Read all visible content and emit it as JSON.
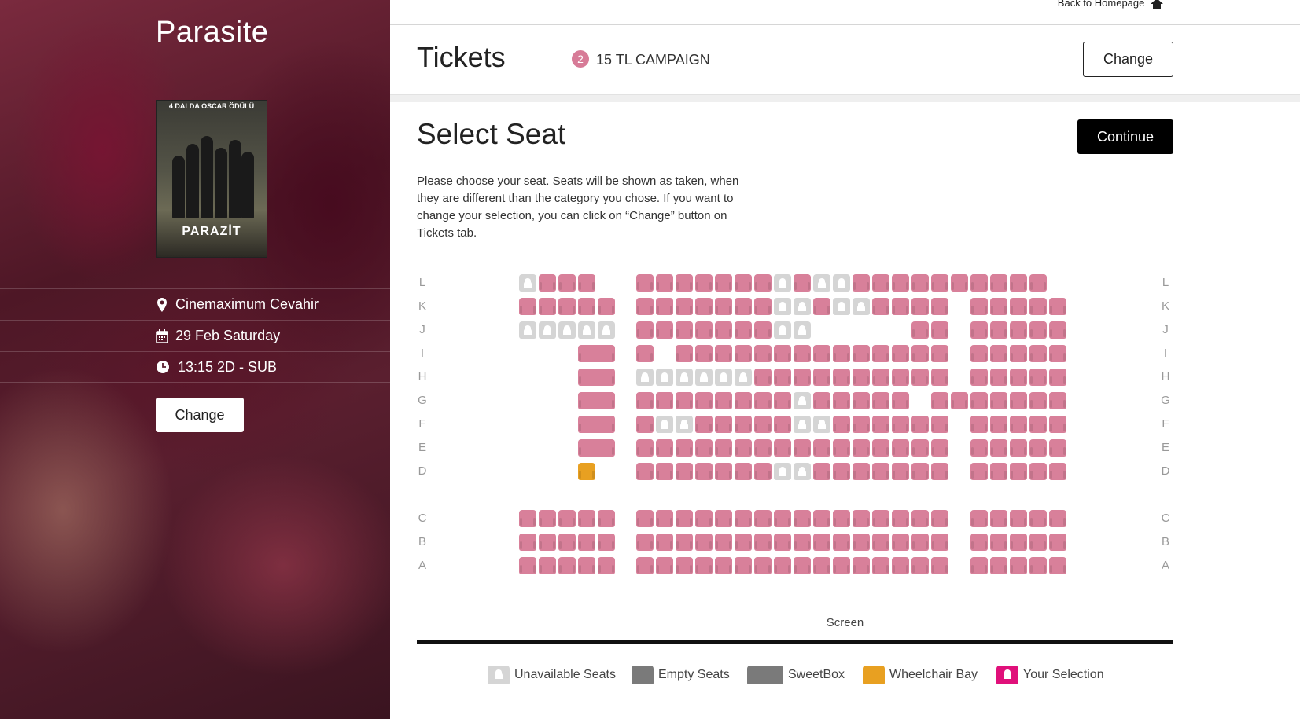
{
  "movie": {
    "title": "Parasite",
    "poster_top_text": "4 DALDA OSCAR ÖDÜLÜ",
    "poster_title": "PARAZİT"
  },
  "info": {
    "cinema": "Cinemaximum Cevahir",
    "date": "29 Feb Saturday",
    "time": "13:15 2D - SUB",
    "change_label": "Change"
  },
  "header": {
    "back_label": "Back to Homepage",
    "tickets_title": "Tickets",
    "badge_count": "2",
    "campaign_label": "15 TL CAMPAIGN",
    "change_label": "Change"
  },
  "seat_section": {
    "title": "Select Seat",
    "continue_label": "Continue",
    "description": "Please choose your seat. Seats will be shown as taken, when they are different than the category you chose. If you want to change your selection, you can click on “Change” button on Tickets tab."
  },
  "seat_map": {
    "rows": [
      "L",
      "K",
      "J",
      "I",
      "H",
      "G",
      "F",
      "E",
      "D",
      "C",
      "B",
      "A"
    ],
    "row_layouts": {
      "L": [
        [
          "u",
          "e",
          "e",
          "e"
        ],
        [
          "e",
          "e",
          "e",
          "e",
          "e",
          "e",
          "e",
          "u",
          "e",
          "u",
          "u",
          "e",
          "e",
          "e",
          "e",
          "e",
          "e",
          "e"
        ],
        [
          "e",
          "e",
          "e",
          "e"
        ]
      ],
      "K": [
        [
          "e",
          "e",
          "e",
          "e",
          "e"
        ],
        [
          "e",
          "e",
          "e",
          "e",
          "e",
          "e",
          "e",
          "u",
          "u",
          "e",
          "u",
          "u",
          "e",
          "e",
          "e",
          "e"
        ],
        [
          "e",
          "e",
          "e",
          "e",
          "e"
        ]
      ],
      "J": [
        [
          "u",
          "u",
          "u",
          "u",
          "u"
        ],
        [
          "e",
          "e",
          "e",
          "e",
          "e",
          "e",
          "e",
          "u",
          "u",
          "-",
          "-",
          "-",
          "-",
          "-",
          "e",
          "e"
        ],
        [
          "e",
          "e",
          "e",
          "e",
          "e"
        ]
      ],
      "I": [
        [
          "-",
          "-",
          "-",
          "S"
        ],
        [
          "e",
          "-",
          "e",
          "e",
          "e",
          "e",
          "e",
          "e",
          "e",
          "e",
          "e",
          "e",
          "e",
          "e",
          "e",
          "e"
        ],
        [
          "e",
          "e",
          "e",
          "e",
          "e"
        ]
      ],
      "H": [
        [
          "-",
          "-",
          "-",
          "S"
        ],
        [
          "u",
          "u",
          "u",
          "u",
          "u",
          "u",
          "e",
          "e",
          "e",
          "e",
          "e",
          "e",
          "e",
          "e",
          "e",
          "e"
        ],
        [
          "e",
          "e",
          "e",
          "e",
          "e"
        ]
      ],
      "G": [
        [
          "-",
          "-",
          "-",
          "S"
        ],
        [
          "e",
          "e",
          "e",
          "e",
          "e",
          "e",
          "e",
          "e",
          "u",
          "e",
          "e",
          "e",
          "e",
          "e",
          "-",
          "e",
          "e"
        ],
        [
          "e",
          "e",
          "e",
          "e",
          "e"
        ]
      ],
      "F": [
        [
          "-",
          "-",
          "-",
          "S"
        ],
        [
          "e",
          "u",
          "u",
          "e",
          "e",
          "e",
          "e",
          "e",
          "u",
          "u",
          "e",
          "e",
          "e",
          "e",
          "e",
          "e",
          "-",
          "e"
        ],
        [
          "e",
          "e",
          "e",
          "e",
          "e"
        ]
      ],
      "E": [
        [
          "-",
          "-",
          "-",
          "S"
        ],
        [
          "e",
          "e",
          "e",
          "e",
          "e",
          "e",
          "e",
          "e",
          "e",
          "e",
          "e",
          "e",
          "e",
          "e",
          "e",
          "e"
        ],
        [
          "e",
          "e",
          "e",
          "e",
          "e"
        ]
      ],
      "D": [
        [
          "-",
          "-",
          "-",
          "w"
        ],
        [
          "e",
          "e",
          "e",
          "e",
          "e",
          "e",
          "e",
          "u",
          "u",
          "e",
          "e",
          "e",
          "e",
          "e",
          "e",
          "e"
        ],
        [
          "e",
          "e",
          "e",
          "e",
          "e"
        ]
      ],
      "C": [
        [
          "e",
          "e",
          "e",
          "e",
          "e"
        ],
        [
          "e",
          "e",
          "e",
          "e",
          "e",
          "e",
          "e",
          "e",
          "e",
          "e",
          "e",
          "e",
          "e",
          "e",
          "e",
          "e"
        ],
        [
          "e",
          "e",
          "e",
          "e",
          "e"
        ]
      ],
      "B": [
        [
          "e",
          "e",
          "e",
          "e",
          "e"
        ],
        [
          "e",
          "e",
          "e",
          "e",
          "e",
          "e",
          "e",
          "e",
          "e",
          "e",
          "e",
          "e",
          "e",
          "e",
          "e",
          "e"
        ],
        [
          "e",
          "e",
          "e",
          "e",
          "e"
        ]
      ],
      "A": [
        [
          "e",
          "e",
          "e",
          "e",
          "e"
        ],
        [
          "e",
          "e",
          "e",
          "e",
          "e",
          "e",
          "e",
          "e",
          "e",
          "e",
          "e",
          "e",
          "e",
          "e",
          "e",
          "e"
        ],
        [
          "e",
          "e",
          "e",
          "e",
          "e"
        ]
      ]
    },
    "screen_label": "Screen"
  },
  "legend": {
    "unavailable": "Unavailable Seats",
    "empty": "Empty Seats",
    "sweetbox": "SweetBox",
    "wheelchair": "Wheelchair Bay",
    "selection": "Your Selection"
  },
  "colors": {
    "seat_empty": "#d8809a",
    "seat_unavailable": "#d5d5d5",
    "seat_wheelchair": "#e8a021",
    "legend_empty": "#7a7a7a",
    "legend_selection": "#e0107a",
    "badge": "#d77b97"
  }
}
